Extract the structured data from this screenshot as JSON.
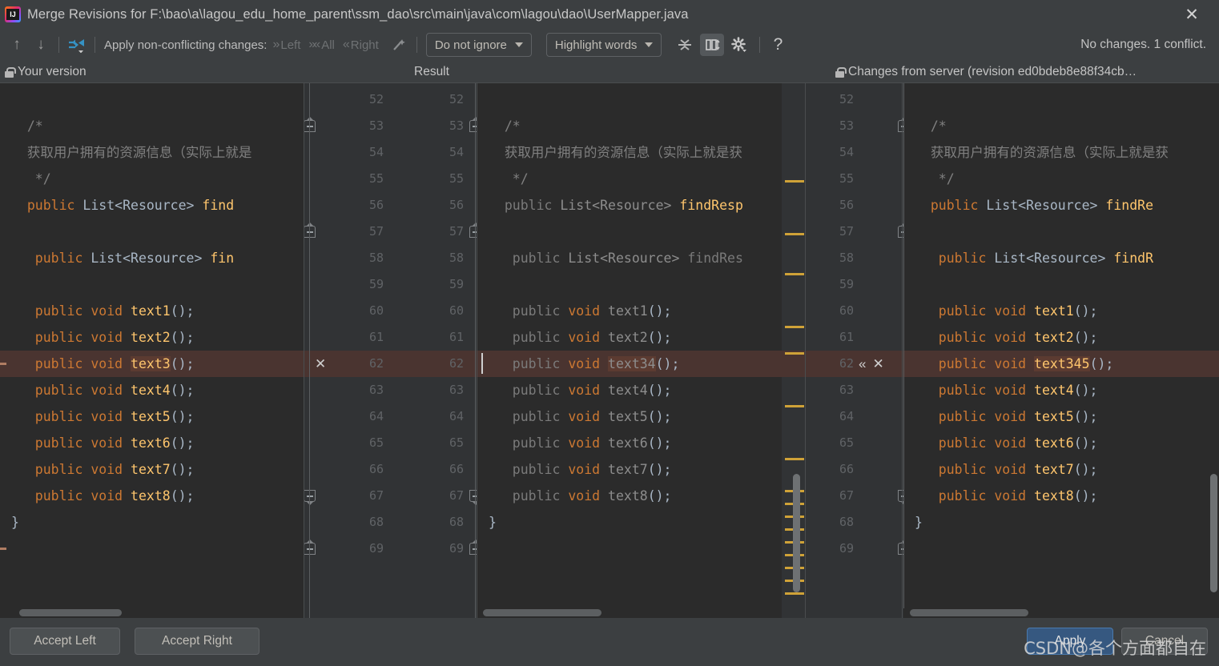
{
  "window": {
    "title": "Merge Revisions for F:\\bao\\a\\lagou_edu_home_parent\\ssm_dao\\src\\main\\java\\com\\lagou\\dao\\UserMapper.java",
    "close_label": "✕",
    "app_icon": "intellij-idea-logo"
  },
  "toolbar": {
    "prev_icon": "↑",
    "next_icon": "↓",
    "magic_resolve_icon": "apply-all-non-conflicting-icon",
    "apply_label": "Apply non-conflicting changes:",
    "left_label": "Left",
    "all_label": "All",
    "right_label": "Right",
    "wand_icon": "magic-wand-icon",
    "ignore_policy": "Do not ignore",
    "highlight_policy": "Highlight words",
    "collapse_icon": "collapse-unchanged-fragments-icon",
    "columns_icon": "editor-columns-icon",
    "settings_icon": "gear-icon",
    "help_icon": "?",
    "status": "No changes. 1 conflict."
  },
  "panes": {
    "left_header": "Your version",
    "mid_header": "Result",
    "right_header": "Changes from server (revision ed0bdeb8e88f34cb…"
  },
  "line_numbers": [
    52,
    53,
    54,
    55,
    56,
    57,
    58,
    59,
    60,
    61,
    62,
    63,
    64,
    65,
    66,
    67,
    68,
    69
  ],
  "conflict": {
    "line": "62",
    "left_accept_icon": "»",
    "left_reject_icon": "✕",
    "right_accept_icon": "«",
    "right_reject_icon": "✕"
  },
  "code": {
    "left": [
      {
        "n": 52,
        "tokens": []
      },
      {
        "n": 53,
        "tokens": [
          {
            "t": "  /*",
            "c": "cmt"
          }
        ]
      },
      {
        "n": 54,
        "tokens": [
          {
            "t": "  获取用户拥有的资源信息（实际上就是",
            "c": "cmt"
          }
        ]
      },
      {
        "n": 55,
        "tokens": [
          {
            "t": "   */",
            "c": "cmt"
          }
        ]
      },
      {
        "n": 56,
        "tokens": [
          {
            "t": "  public ",
            "c": "kw"
          },
          {
            "t": "List<Resource> ",
            "c": "typ"
          },
          {
            "t": "find",
            "c": "mth"
          }
        ]
      },
      {
        "n": 57,
        "tokens": []
      },
      {
        "n": 58,
        "tokens": [
          {
            "t": "   public ",
            "c": "kw"
          },
          {
            "t": "List<Resource> ",
            "c": "typ"
          },
          {
            "t": "fin",
            "c": "mth"
          }
        ]
      },
      {
        "n": 59,
        "tokens": []
      },
      {
        "n": 60,
        "tokens": [
          {
            "t": "   public void ",
            "c": "kw"
          },
          {
            "t": "text1",
            "c": "mth"
          },
          {
            "t": "();",
            "c": "brc"
          }
        ]
      },
      {
        "n": 61,
        "tokens": [
          {
            "t": "   public void ",
            "c": "kw"
          },
          {
            "t": "text2",
            "c": "mth"
          },
          {
            "t": "();",
            "c": "brc"
          }
        ]
      },
      {
        "n": 62,
        "tokens": [
          {
            "t": "   public void ",
            "c": "kw"
          },
          {
            "t": "text3",
            "c": "mth hl"
          },
          {
            "t": "();",
            "c": "brc"
          }
        ],
        "conflict": true
      },
      {
        "n": 63,
        "tokens": [
          {
            "t": "   public void ",
            "c": "kw"
          },
          {
            "t": "text4",
            "c": "mth"
          },
          {
            "t": "();",
            "c": "brc"
          }
        ]
      },
      {
        "n": 64,
        "tokens": [
          {
            "t": "   public void ",
            "c": "kw"
          },
          {
            "t": "text5",
            "c": "mth"
          },
          {
            "t": "();",
            "c": "brc"
          }
        ]
      },
      {
        "n": 65,
        "tokens": [
          {
            "t": "   public void ",
            "c": "kw"
          },
          {
            "t": "text6",
            "c": "mth"
          },
          {
            "t": "();",
            "c": "brc"
          }
        ]
      },
      {
        "n": 66,
        "tokens": [
          {
            "t": "   public void ",
            "c": "kw"
          },
          {
            "t": "text7",
            "c": "mth"
          },
          {
            "t": "();",
            "c": "brc"
          }
        ]
      },
      {
        "n": 67,
        "tokens": [
          {
            "t": "   public void ",
            "c": "kw"
          },
          {
            "t": "text8",
            "c": "mth"
          },
          {
            "t": "();",
            "c": "brc"
          }
        ]
      },
      {
        "n": 68,
        "tokens": [
          {
            "t": "}",
            "c": "brc"
          }
        ]
      },
      {
        "n": 69,
        "tokens": []
      }
    ],
    "mid": [
      {
        "n": 52,
        "tokens": []
      },
      {
        "n": 53,
        "tokens": [
          {
            "t": "  /*",
            "c": "cmt"
          }
        ]
      },
      {
        "n": 54,
        "tokens": [
          {
            "t": "  获取用户拥有的资源信息（实际上就是获",
            "c": "cmt"
          }
        ]
      },
      {
        "n": 55,
        "tokens": [
          {
            "t": "   */",
            "c": "cmt"
          }
        ]
      },
      {
        "n": 56,
        "tokens": [
          {
            "t": "  public ",
            "c": "dim"
          },
          {
            "t": "List<Resource> ",
            "c": "dimk"
          },
          {
            "t": "findResp",
            "c": "mth"
          }
        ]
      },
      {
        "n": 57,
        "tokens": []
      },
      {
        "n": 58,
        "tokens": [
          {
            "t": "   public ",
            "c": "dim"
          },
          {
            "t": "List<Resource> ",
            "c": "dimk"
          },
          {
            "t": "findRes",
            "c": "dim"
          }
        ]
      },
      {
        "n": 59,
        "tokens": []
      },
      {
        "n": 60,
        "tokens": [
          {
            "t": "   public ",
            "c": "dim"
          },
          {
            "t": "void ",
            "c": "kw"
          },
          {
            "t": "text1",
            "c": "dimk"
          },
          {
            "t": "();",
            "c": "brc"
          }
        ]
      },
      {
        "n": 61,
        "tokens": [
          {
            "t": "   public ",
            "c": "dim"
          },
          {
            "t": "void ",
            "c": "kw"
          },
          {
            "t": "text2",
            "c": "dimk"
          },
          {
            "t": "();",
            "c": "brc"
          }
        ]
      },
      {
        "n": 62,
        "tokens": [
          {
            "t": "   public ",
            "c": "dim"
          },
          {
            "t": "void ",
            "c": "kw"
          },
          {
            "t": "text34",
            "c": "dimk hl"
          },
          {
            "t": "();",
            "c": "brc"
          }
        ],
        "conflict": true
      },
      {
        "n": 63,
        "tokens": [
          {
            "t": "   public ",
            "c": "dim"
          },
          {
            "t": "void ",
            "c": "kw"
          },
          {
            "t": "text4",
            "c": "dimk"
          },
          {
            "t": "();",
            "c": "brc"
          }
        ]
      },
      {
        "n": 64,
        "tokens": [
          {
            "t": "   public ",
            "c": "dim"
          },
          {
            "t": "void ",
            "c": "kw"
          },
          {
            "t": "text5",
            "c": "dimk"
          },
          {
            "t": "();",
            "c": "brc"
          }
        ]
      },
      {
        "n": 65,
        "tokens": [
          {
            "t": "   public ",
            "c": "dim"
          },
          {
            "t": "void ",
            "c": "kw"
          },
          {
            "t": "text6",
            "c": "dimk"
          },
          {
            "t": "();",
            "c": "brc"
          }
        ]
      },
      {
        "n": 66,
        "tokens": [
          {
            "t": "   public ",
            "c": "dim"
          },
          {
            "t": "void ",
            "c": "kw"
          },
          {
            "t": "text7",
            "c": "dimk"
          },
          {
            "t": "();",
            "c": "brc"
          }
        ]
      },
      {
        "n": 67,
        "tokens": [
          {
            "t": "   public ",
            "c": "dim"
          },
          {
            "t": "void ",
            "c": "kw"
          },
          {
            "t": "text8",
            "c": "dimk"
          },
          {
            "t": "();",
            "c": "brc"
          }
        ]
      },
      {
        "n": 68,
        "tokens": [
          {
            "t": "}",
            "c": "brc"
          }
        ]
      },
      {
        "n": 69,
        "tokens": []
      }
    ],
    "right": [
      {
        "n": 52,
        "tokens": []
      },
      {
        "n": 53,
        "tokens": [
          {
            "t": "  /*",
            "c": "cmt"
          }
        ]
      },
      {
        "n": 54,
        "tokens": [
          {
            "t": "  获取用户拥有的资源信息（实际上就是获",
            "c": "cmt"
          }
        ]
      },
      {
        "n": 55,
        "tokens": [
          {
            "t": "   */",
            "c": "cmt"
          }
        ]
      },
      {
        "n": 56,
        "tokens": [
          {
            "t": "  public ",
            "c": "kw"
          },
          {
            "t": "List<Resource> ",
            "c": "typ"
          },
          {
            "t": "findRe",
            "c": "mth"
          }
        ]
      },
      {
        "n": 57,
        "tokens": []
      },
      {
        "n": 58,
        "tokens": [
          {
            "t": "   public ",
            "c": "kw"
          },
          {
            "t": "List<Resource> ",
            "c": "typ"
          },
          {
            "t": "findR",
            "c": "mth"
          }
        ]
      },
      {
        "n": 59,
        "tokens": []
      },
      {
        "n": 60,
        "tokens": [
          {
            "t": "   public void ",
            "c": "kw"
          },
          {
            "t": "text1",
            "c": "mth"
          },
          {
            "t": "();",
            "c": "brc"
          }
        ]
      },
      {
        "n": 61,
        "tokens": [
          {
            "t": "   public void ",
            "c": "kw"
          },
          {
            "t": "text2",
            "c": "mth"
          },
          {
            "t": "();",
            "c": "brc"
          }
        ]
      },
      {
        "n": 62,
        "tokens": [
          {
            "t": "   public void ",
            "c": "kw"
          },
          {
            "t": "text345",
            "c": "mth hl"
          },
          {
            "t": "();",
            "c": "brc"
          }
        ],
        "conflict": true
      },
      {
        "n": 63,
        "tokens": [
          {
            "t": "   public void ",
            "c": "kw"
          },
          {
            "t": "text4",
            "c": "mth"
          },
          {
            "t": "();",
            "c": "brc"
          }
        ]
      },
      {
        "n": 64,
        "tokens": [
          {
            "t": "   public void ",
            "c": "kw"
          },
          {
            "t": "text5",
            "c": "mth"
          },
          {
            "t": "();",
            "c": "brc"
          }
        ]
      },
      {
        "n": 65,
        "tokens": [
          {
            "t": "   public void ",
            "c": "kw"
          },
          {
            "t": "text6",
            "c": "mth"
          },
          {
            "t": "();",
            "c": "brc"
          }
        ]
      },
      {
        "n": 66,
        "tokens": [
          {
            "t": "   public void ",
            "c": "kw"
          },
          {
            "t": "text7",
            "c": "mth"
          },
          {
            "t": "();",
            "c": "brc"
          }
        ]
      },
      {
        "n": 67,
        "tokens": [
          {
            "t": "   public void ",
            "c": "kw"
          },
          {
            "t": "text8",
            "c": "mth"
          },
          {
            "t": "();",
            "c": "brc"
          }
        ]
      },
      {
        "n": 68,
        "tokens": [
          {
            "t": "}",
            "c": "brc"
          }
        ]
      },
      {
        "n": 69,
        "tokens": []
      }
    ]
  },
  "footer": {
    "accept_left": "Accept Left",
    "accept_right": "Accept Right",
    "apply": "Apply",
    "cancel": "Cancel",
    "watermark": "CSDN@各个方面都自在"
  },
  "colors": {
    "accent": "#365880",
    "conflict_bg": "#4a3430",
    "change_marker": "#cfa238",
    "keyword": "#cc7832",
    "method": "#ffc66d",
    "type": "#a9b7c6"
  }
}
